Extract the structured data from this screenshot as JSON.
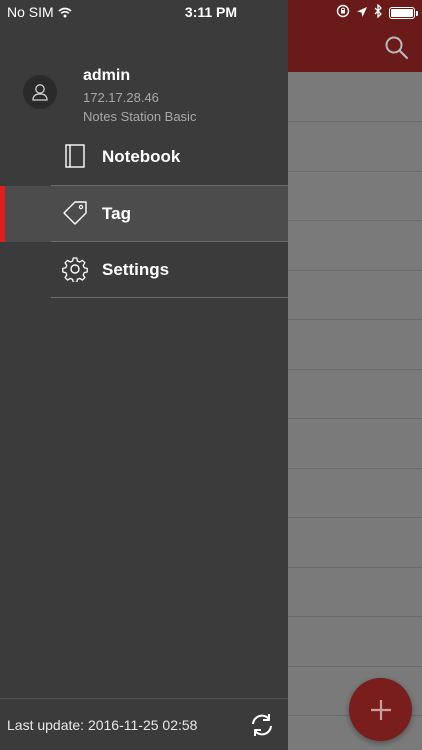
{
  "status_bar": {
    "carrier": "No SIM",
    "time": "3:11 PM"
  },
  "drawer": {
    "user": {
      "name": "admin",
      "ip": "172.17.28.46",
      "app": "Notes Station Basic"
    },
    "menu": [
      {
        "label": "Notebook",
        "icon": "notebook-icon",
        "active": false
      },
      {
        "label": "Tag",
        "icon": "tag-icon",
        "active": true
      },
      {
        "label": "Settings",
        "icon": "gear-icon",
        "active": false
      }
    ],
    "footer": {
      "last_update": "Last update: 2016-11-25 02:58"
    }
  },
  "colors": {
    "accent_red": "#e11d1d",
    "header_red": "#6b1a1a",
    "drawer_bg": "#3b3b3b"
  }
}
